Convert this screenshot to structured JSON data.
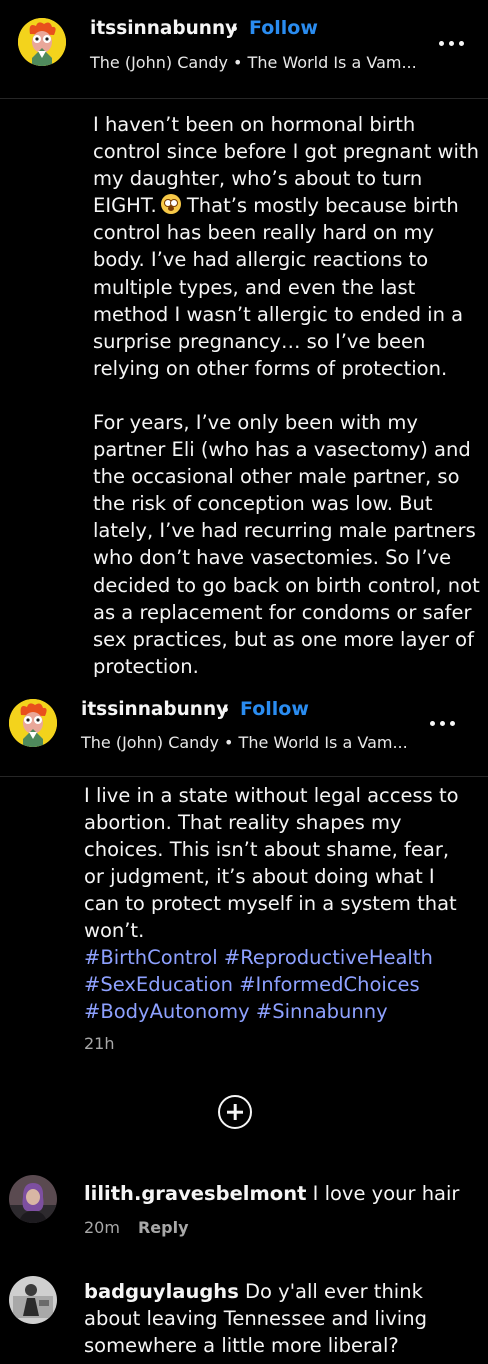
{
  "post1": {
    "username": "itssinnabunny",
    "separator": "•",
    "follow_label": "Follow",
    "audio": "The (John) Candy • The World Is a Vam...",
    "more_icon": "more-horizontal-icon"
  },
  "caption1": {
    "para1": "I haven’t been on hormonal birth control since before I got pregnant with my daughter, who’s about to turn EIGHT.",
    "para1_emoji": "flushed-face-emoji",
    "para1_rest": "That’s mostly because birth control has been really hard on my body. I’ve had allergic reactions to multiple types, and even the last method I wasn’t allergic to ended in a surprise pregnancy… so I’ve been relying on other forms of protection.",
    "para2": "For years, I’ve only been with my partner Eli (who has a vasectomy) and the occasional other male partner, so the risk of conception was low. But lately, I’ve had recurring male partners who don’t have vasectomies. So I’ve decided to go back on birth control, not as a replacement for condoms or safer sex practices, but as one more layer of protection."
  },
  "post2": {
    "username": "itssinnabunny",
    "separator": "•",
    "follow_label": "Follow",
    "audio": "The (John) Candy • The World Is a Vam...",
    "more_icon": "more-horizontal-icon"
  },
  "caption2": {
    "text": "I live in a state without legal access to abortion. That reality shapes my choices. This isn’t about shame, fear, or judgment, it’s about doing what I can to protect myself in a system that won’t.",
    "hashtags": [
      "#BirthControl",
      "#ReproductiveHealth",
      "#SexEducation",
      "#InformedChoices",
      "#BodyAutonomy",
      "#Sinnabunny"
    ],
    "time": "21h"
  },
  "add_comment_icon": "plus-circle-icon",
  "comments": [
    {
      "username": "lilith.gravesbelmont",
      "text": "I love your hair",
      "time": "20m",
      "reply_label": "Reply"
    },
    {
      "username": "badguylaughs",
      "text": "Do y'all ever think about leaving Tennessee and living somewhere a little more liberal?"
    }
  ],
  "colors": {
    "background": "#000000",
    "follow": "#2a8cf0",
    "hashtag": "#8ea1ff",
    "meta": "#a8a8a8"
  }
}
